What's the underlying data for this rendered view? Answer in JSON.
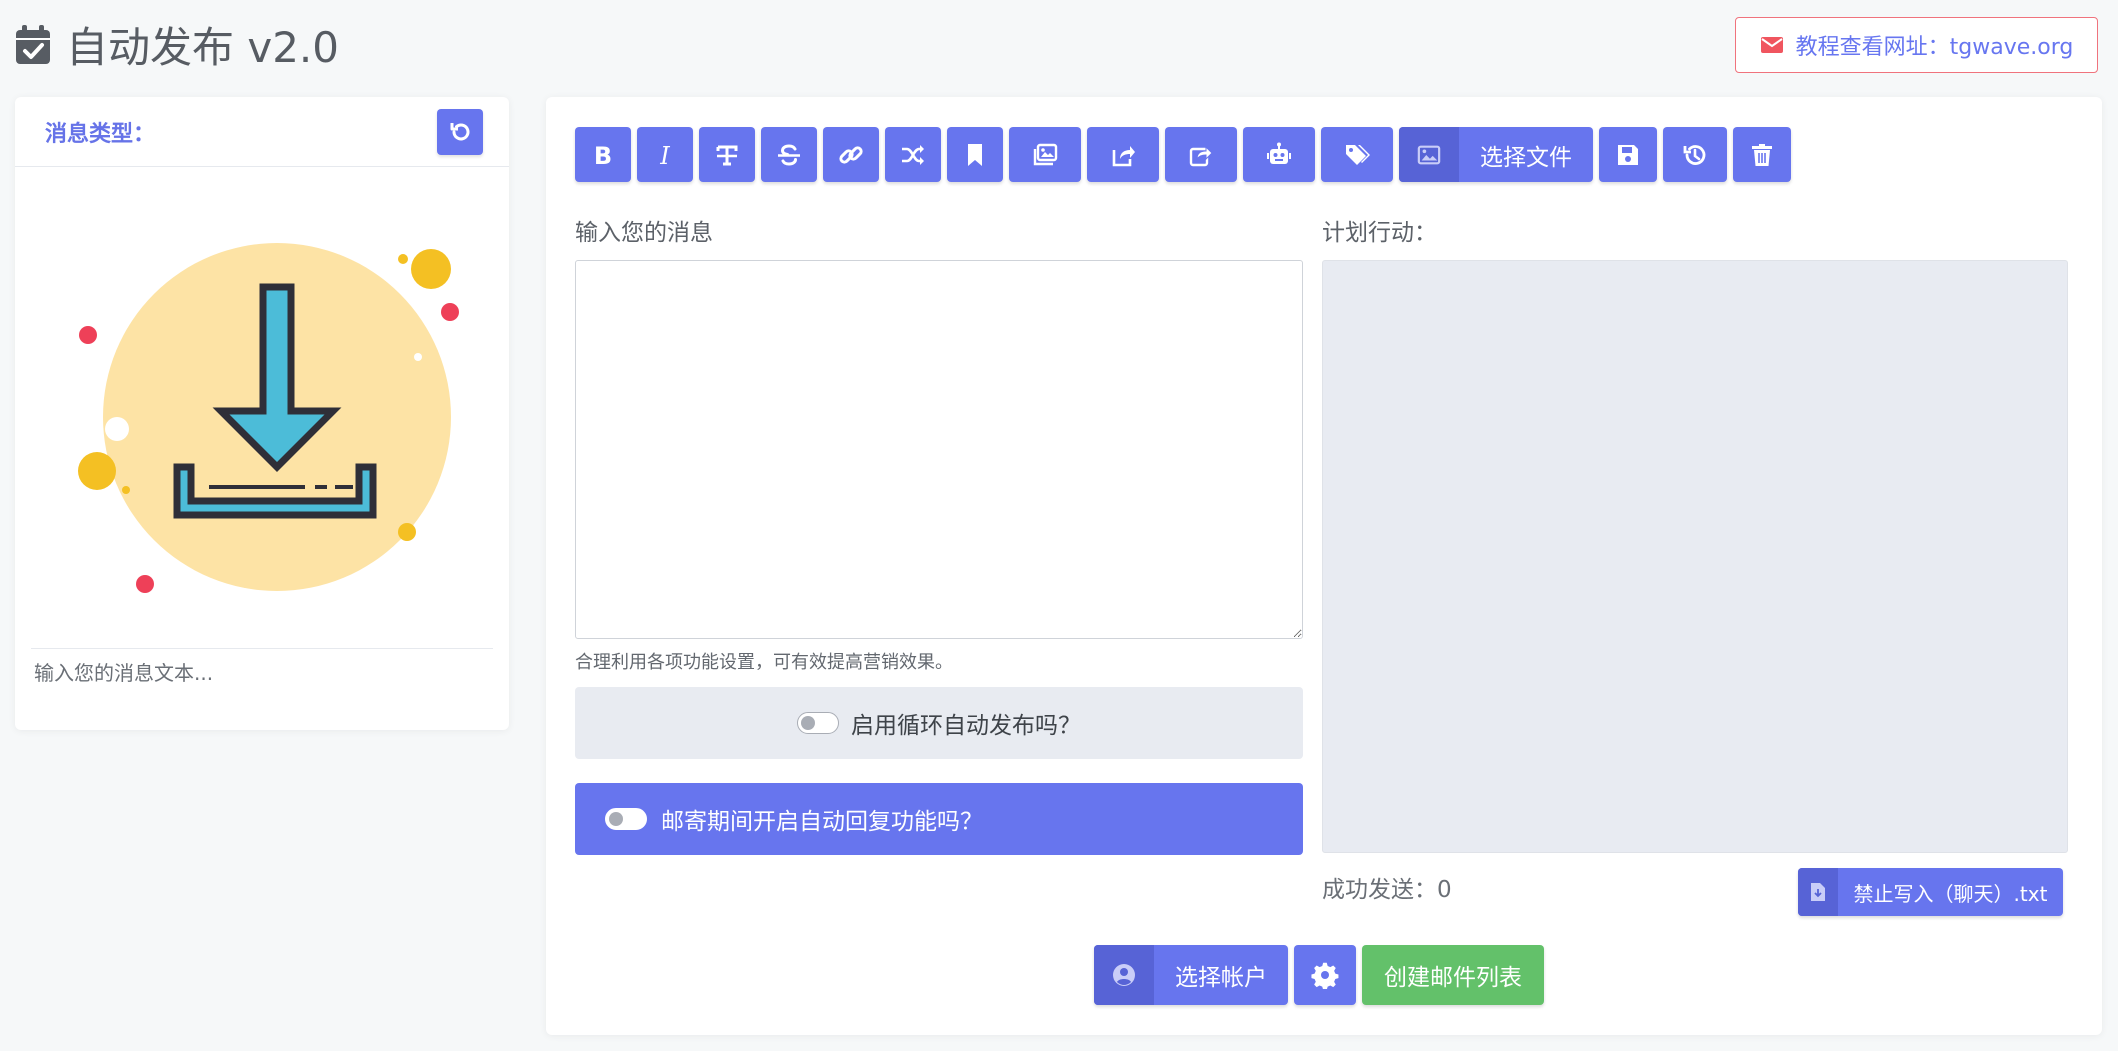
{
  "header": {
    "title": "自动发布 v2.0",
    "tutorial_link": "教程查看网址：tgwave.org"
  },
  "left_panel": {
    "message_type_label": "消息类型：",
    "preview_text": "输入您的消息文本..."
  },
  "toolbar": {
    "items": [
      {
        "name": "bold",
        "icon": "bold-icon"
      },
      {
        "name": "italic",
        "icon": "italic-icon"
      },
      {
        "name": "text-format",
        "icon": "text-format-icon"
      },
      {
        "name": "strikethrough",
        "icon": "strikethrough-icon"
      },
      {
        "name": "link",
        "icon": "link-icon"
      },
      {
        "name": "shuffle",
        "icon": "shuffle-icon"
      },
      {
        "name": "bookmark",
        "icon": "bookmark-icon"
      },
      {
        "name": "images",
        "icon": "images-icon"
      },
      {
        "name": "share",
        "icon": "share-icon"
      },
      {
        "name": "forward",
        "icon": "forward-icon"
      },
      {
        "name": "robot",
        "icon": "robot-icon"
      },
      {
        "name": "tags",
        "icon": "tags-icon"
      },
      {
        "name": "save",
        "icon": "save-icon"
      },
      {
        "name": "history",
        "icon": "history-icon"
      },
      {
        "name": "delete",
        "icon": "trash-icon"
      }
    ],
    "file_button_label": "选择文件"
  },
  "message": {
    "label": "输入您的消息",
    "value": "",
    "hint": "合理利用各项功能设置，可有效提高营销效果。"
  },
  "loop_toggle": {
    "label": "启用循环自动发布吗？",
    "checked": false
  },
  "autoreply_toggle": {
    "label": "邮寄期间开启自动回复功能吗？",
    "checked": false
  },
  "plan": {
    "label": "计划行动："
  },
  "stats": {
    "sent_success": "成功发送：0"
  },
  "txt_button": {
    "label": "禁止写入（聊天）.txt"
  },
  "bottom": {
    "select_account": "选择帐户",
    "create_mail_list": "创建邮件列表"
  },
  "colors": {
    "primary": "#6775ee",
    "primary_dark": "#5763d6",
    "success": "#63c16a",
    "danger_border": "#f0737d",
    "label_blue": "#6673e8"
  }
}
